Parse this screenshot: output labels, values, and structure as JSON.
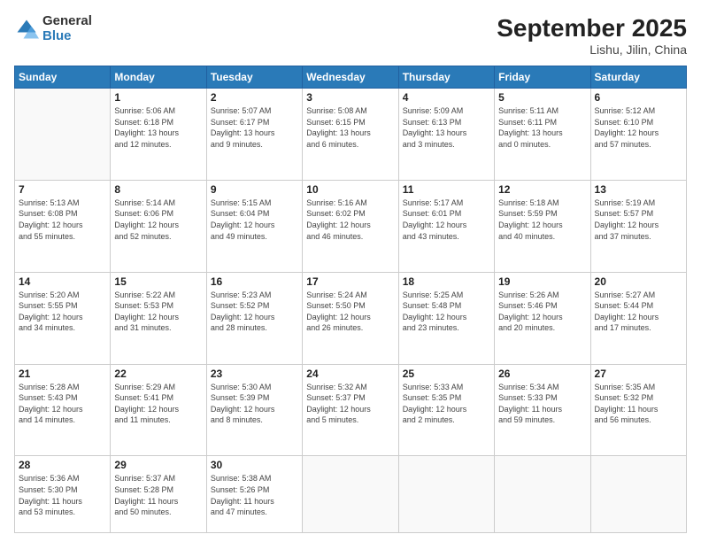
{
  "logo": {
    "general": "General",
    "blue": "Blue"
  },
  "header": {
    "month": "September 2025",
    "location": "Lishu, Jilin, China"
  },
  "weekdays": [
    "Sunday",
    "Monday",
    "Tuesday",
    "Wednesday",
    "Thursday",
    "Friday",
    "Saturday"
  ],
  "weeks": [
    [
      {
        "day": "",
        "info": ""
      },
      {
        "day": "1",
        "info": "Sunrise: 5:06 AM\nSunset: 6:18 PM\nDaylight: 13 hours\nand 12 minutes."
      },
      {
        "day": "2",
        "info": "Sunrise: 5:07 AM\nSunset: 6:17 PM\nDaylight: 13 hours\nand 9 minutes."
      },
      {
        "day": "3",
        "info": "Sunrise: 5:08 AM\nSunset: 6:15 PM\nDaylight: 13 hours\nand 6 minutes."
      },
      {
        "day": "4",
        "info": "Sunrise: 5:09 AM\nSunset: 6:13 PM\nDaylight: 13 hours\nand 3 minutes."
      },
      {
        "day": "5",
        "info": "Sunrise: 5:11 AM\nSunset: 6:11 PM\nDaylight: 13 hours\nand 0 minutes."
      },
      {
        "day": "6",
        "info": "Sunrise: 5:12 AM\nSunset: 6:10 PM\nDaylight: 12 hours\nand 57 minutes."
      }
    ],
    [
      {
        "day": "7",
        "info": "Sunrise: 5:13 AM\nSunset: 6:08 PM\nDaylight: 12 hours\nand 55 minutes."
      },
      {
        "day": "8",
        "info": "Sunrise: 5:14 AM\nSunset: 6:06 PM\nDaylight: 12 hours\nand 52 minutes."
      },
      {
        "day": "9",
        "info": "Sunrise: 5:15 AM\nSunset: 6:04 PM\nDaylight: 12 hours\nand 49 minutes."
      },
      {
        "day": "10",
        "info": "Sunrise: 5:16 AM\nSunset: 6:02 PM\nDaylight: 12 hours\nand 46 minutes."
      },
      {
        "day": "11",
        "info": "Sunrise: 5:17 AM\nSunset: 6:01 PM\nDaylight: 12 hours\nand 43 minutes."
      },
      {
        "day": "12",
        "info": "Sunrise: 5:18 AM\nSunset: 5:59 PM\nDaylight: 12 hours\nand 40 minutes."
      },
      {
        "day": "13",
        "info": "Sunrise: 5:19 AM\nSunset: 5:57 PM\nDaylight: 12 hours\nand 37 minutes."
      }
    ],
    [
      {
        "day": "14",
        "info": "Sunrise: 5:20 AM\nSunset: 5:55 PM\nDaylight: 12 hours\nand 34 minutes."
      },
      {
        "day": "15",
        "info": "Sunrise: 5:22 AM\nSunset: 5:53 PM\nDaylight: 12 hours\nand 31 minutes."
      },
      {
        "day": "16",
        "info": "Sunrise: 5:23 AM\nSunset: 5:52 PM\nDaylight: 12 hours\nand 28 minutes."
      },
      {
        "day": "17",
        "info": "Sunrise: 5:24 AM\nSunset: 5:50 PM\nDaylight: 12 hours\nand 26 minutes."
      },
      {
        "day": "18",
        "info": "Sunrise: 5:25 AM\nSunset: 5:48 PM\nDaylight: 12 hours\nand 23 minutes."
      },
      {
        "day": "19",
        "info": "Sunrise: 5:26 AM\nSunset: 5:46 PM\nDaylight: 12 hours\nand 20 minutes."
      },
      {
        "day": "20",
        "info": "Sunrise: 5:27 AM\nSunset: 5:44 PM\nDaylight: 12 hours\nand 17 minutes."
      }
    ],
    [
      {
        "day": "21",
        "info": "Sunrise: 5:28 AM\nSunset: 5:43 PM\nDaylight: 12 hours\nand 14 minutes."
      },
      {
        "day": "22",
        "info": "Sunrise: 5:29 AM\nSunset: 5:41 PM\nDaylight: 12 hours\nand 11 minutes."
      },
      {
        "day": "23",
        "info": "Sunrise: 5:30 AM\nSunset: 5:39 PM\nDaylight: 12 hours\nand 8 minutes."
      },
      {
        "day": "24",
        "info": "Sunrise: 5:32 AM\nSunset: 5:37 PM\nDaylight: 12 hours\nand 5 minutes."
      },
      {
        "day": "25",
        "info": "Sunrise: 5:33 AM\nSunset: 5:35 PM\nDaylight: 12 hours\nand 2 minutes."
      },
      {
        "day": "26",
        "info": "Sunrise: 5:34 AM\nSunset: 5:33 PM\nDaylight: 11 hours\nand 59 minutes."
      },
      {
        "day": "27",
        "info": "Sunrise: 5:35 AM\nSunset: 5:32 PM\nDaylight: 11 hours\nand 56 minutes."
      }
    ],
    [
      {
        "day": "28",
        "info": "Sunrise: 5:36 AM\nSunset: 5:30 PM\nDaylight: 11 hours\nand 53 minutes."
      },
      {
        "day": "29",
        "info": "Sunrise: 5:37 AM\nSunset: 5:28 PM\nDaylight: 11 hours\nand 50 minutes."
      },
      {
        "day": "30",
        "info": "Sunrise: 5:38 AM\nSunset: 5:26 PM\nDaylight: 11 hours\nand 47 minutes."
      },
      {
        "day": "",
        "info": ""
      },
      {
        "day": "",
        "info": ""
      },
      {
        "day": "",
        "info": ""
      },
      {
        "day": "",
        "info": ""
      }
    ]
  ]
}
